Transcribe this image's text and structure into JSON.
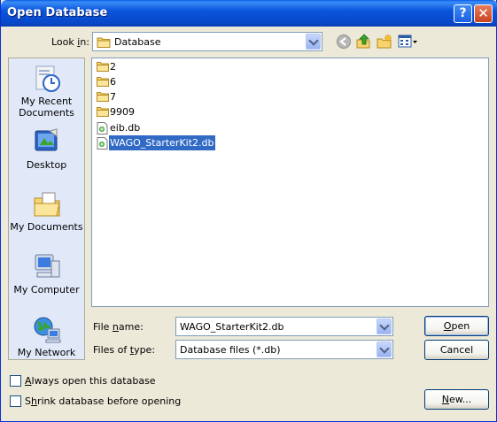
{
  "window": {
    "title": "Open Database"
  },
  "titlebar": {
    "help_label": "?",
    "close_label": "✕"
  },
  "lookin": {
    "label_pre": "Look ",
    "label_key": "i",
    "label_post": "n:",
    "value": "Database"
  },
  "toolbar": {
    "icons": [
      "back-icon",
      "up-folder-icon",
      "new-folder-icon",
      "views-menu-icon"
    ]
  },
  "places": [
    {
      "label": "My Recent Documents",
      "icon": "recent-documents-icon"
    },
    {
      "label": "Desktop",
      "icon": "desktop-icon"
    },
    {
      "label": "My Documents",
      "icon": "my-documents-icon"
    },
    {
      "label": "My Computer",
      "icon": "my-computer-icon"
    },
    {
      "label": "My Network",
      "icon": "my-network-icon"
    }
  ],
  "files": [
    {
      "name": "2",
      "type": "folder"
    },
    {
      "name": "6",
      "type": "folder"
    },
    {
      "name": "7",
      "type": "folder"
    },
    {
      "name": "9909",
      "type": "folder"
    },
    {
      "name": "eib.db",
      "type": "db"
    },
    {
      "name": "WAGO_StarterKit2.db",
      "type": "db",
      "selected": true
    }
  ],
  "filename": {
    "label_pre": "File ",
    "label_key": "n",
    "label_post": "ame:",
    "value": "WAGO_StarterKit2.db"
  },
  "filetype": {
    "label_pre": "Files of ",
    "label_key": "t",
    "label_post": "ype:",
    "value": "Database files (*.db)"
  },
  "buttons": {
    "open_key": "O",
    "open_rest": "pen",
    "cancel": "Cancel",
    "new_key": "N",
    "new_rest": "ew..."
  },
  "options": {
    "always_open_key": "A",
    "always_open_rest": "lways open this database",
    "always_open_checked": false,
    "shrink_pre": "S",
    "shrink_key": "h",
    "shrink_rest": "rink database before opening",
    "shrink_checked": false
  },
  "colors": {
    "title_bar": "#0a55dd",
    "selection": "#316ac5",
    "dialog_bg": "#ece9d8"
  }
}
